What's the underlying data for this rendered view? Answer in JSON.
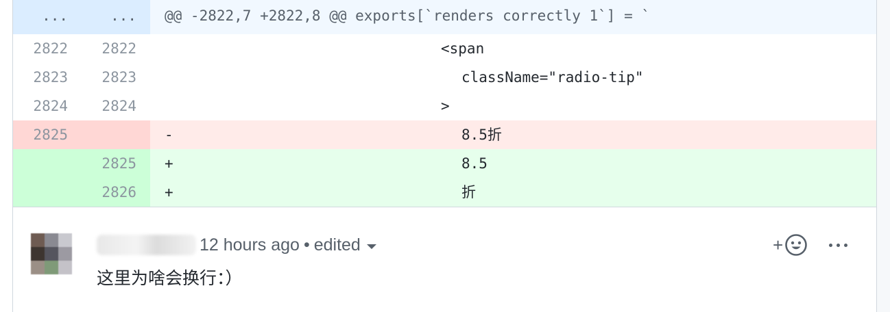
{
  "hunk": {
    "old_num": "...",
    "new_num": "...",
    "header": "@@ -2822,7 +2822,8 @@ exports[`renders correctly 1`] = `"
  },
  "lines": [
    {
      "old": "2822",
      "new": "2822",
      "marker": "",
      "text": "<span",
      "type": "context"
    },
    {
      "old": "2823",
      "new": "2823",
      "marker": "",
      "text": "className=\"radio-tip\"",
      "type": "context"
    },
    {
      "old": "2824",
      "new": "2824",
      "marker": "",
      "text": ">",
      "type": "context"
    },
    {
      "old": "2825",
      "new": "",
      "marker": "-",
      "text": "8.5折",
      "type": "del"
    },
    {
      "old": "",
      "new": "2825",
      "marker": "+",
      "text": "8.5",
      "type": "add"
    },
    {
      "old": "",
      "new": "2826",
      "marker": "+",
      "text": "折",
      "type": "add"
    }
  ],
  "comment": {
    "time": "12 hours ago",
    "separator": "•",
    "edited": "edited",
    "body": "这里为啥会换行：）",
    "reaction_icon": "add-reaction-smiley-icon",
    "reaction_plus": "+",
    "more_icon": "kebab-horizontal-icon"
  },
  "colors": {
    "hunk_bg": "#f1f8ff",
    "del_bg": "#ffebe9",
    "add_bg": "#e6ffec"
  }
}
